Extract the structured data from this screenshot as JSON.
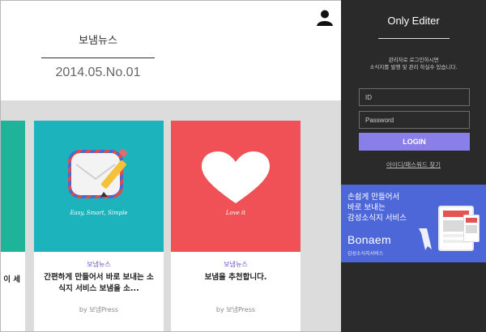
{
  "header": {
    "brand": "보냄뉴스",
    "issue": "2014.05.No.01"
  },
  "cards": [
    {
      "title": "이 세",
      "color": "#1fb39a"
    },
    {
      "caption": "Easy, Smart, Simple",
      "category": "보냄뉴스",
      "title": "간편하게 만들어서 바로 보내는 소식지 서비스 보냄을 소...",
      "by": "by 보냄Press",
      "color": "#1db3bd",
      "icon": "mail-envelope-icon"
    },
    {
      "caption": "Love it",
      "category": "보냄뉴스",
      "title": "보냄을 추천합니다.",
      "by": "by 보냄Press",
      "color": "#ef5157",
      "icon": "heart-icon"
    }
  ],
  "sidebar": {
    "title": "Only Editer",
    "desc_line1": "관리자로 로그인하시면",
    "desc_line2": "소식지를 발행 및 관리 하실수 있습니다.",
    "id_placeholder": "ID",
    "password_placeholder": "Password",
    "login_label": "LOGIN",
    "find_label": "아이디/패스워드 찾기",
    "banner": {
      "line1": "손쉽게 만들어서",
      "line2": "바로 보내는",
      "line3": "감성소식지 서비스",
      "logo": "Bonaem",
      "sub": "감성소식지서비스",
      "color": "#4e67d8"
    }
  },
  "colors": {
    "sidebar_bg": "#2a2a2a",
    "accent": "#8a7fe8",
    "gallery_bg": "#dcdcdc"
  }
}
